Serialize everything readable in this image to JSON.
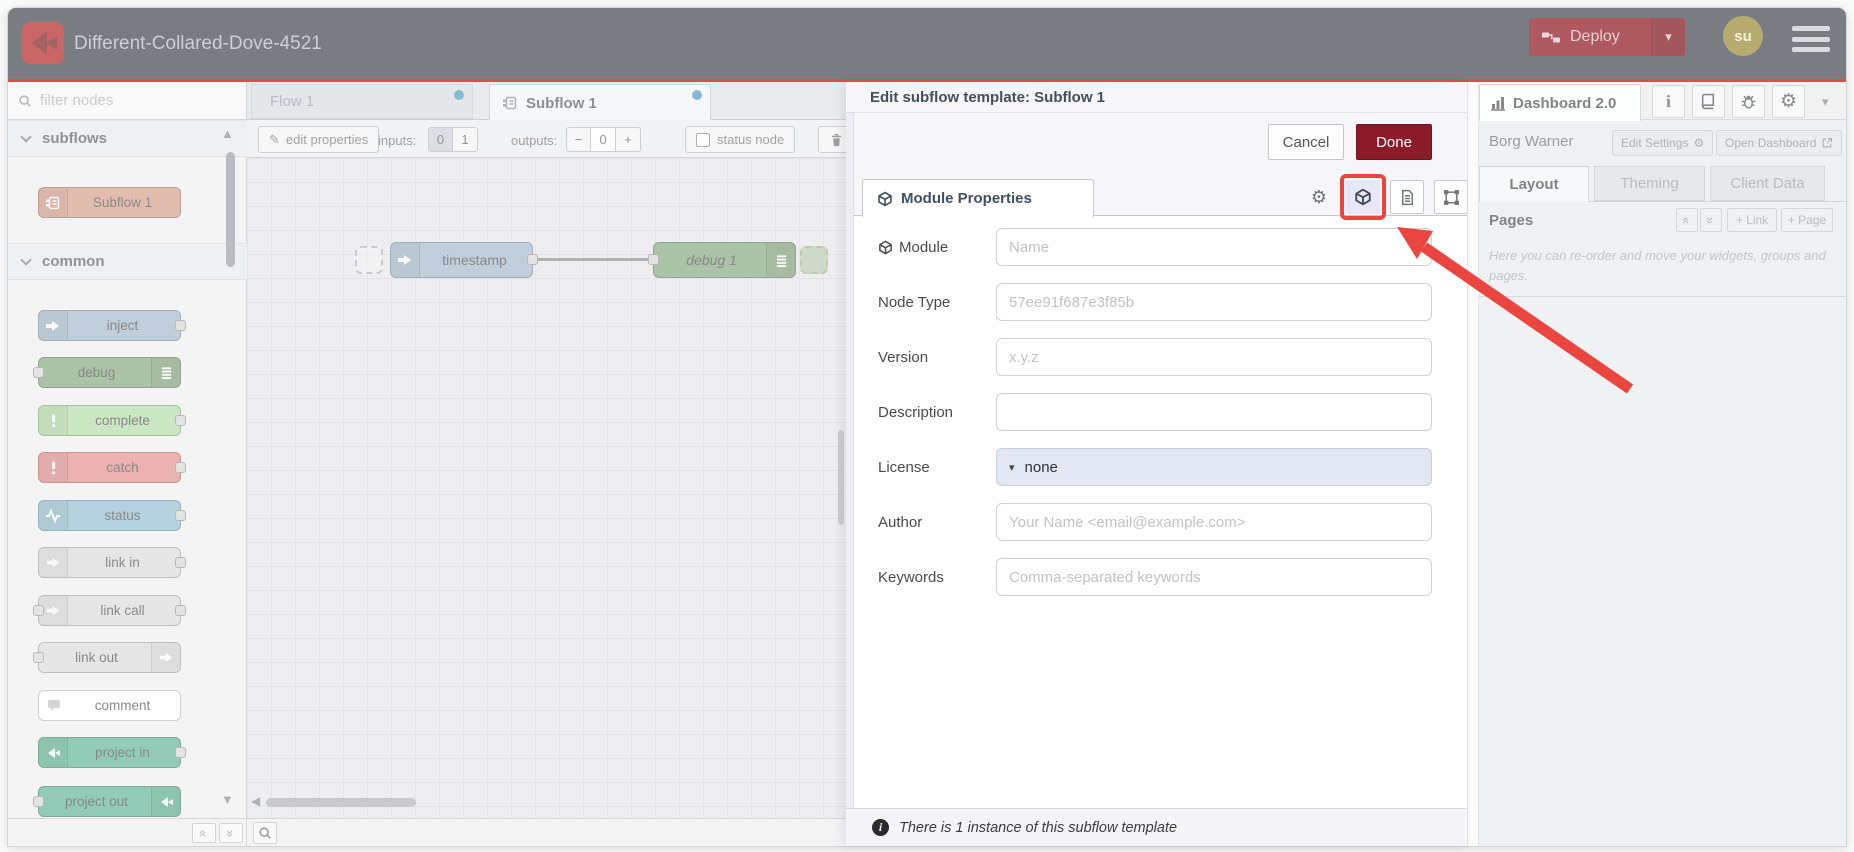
{
  "header": {
    "title": "Different-Collared-Dove-4521",
    "deploy": "Deploy",
    "avatar": "su"
  },
  "icons": {
    "gear": "⚙",
    "pencil": "✎",
    "chevron_down": "▾",
    "triangle_up": "▲",
    "triangle_down": "▼",
    "triangle_left": "◀",
    "double_chevron_up": "«",
    "double_chevron_down": "»",
    "info": "i",
    "exclamation": "!"
  },
  "palette": {
    "filter_placeholder": "filter nodes",
    "sections": [
      {
        "label": "subflows"
      },
      {
        "label": "common"
      }
    ],
    "subflows": [
      {
        "label": "Subflow 1",
        "color": "#d6a18d"
      }
    ],
    "common": [
      {
        "label": "inject",
        "color": "#a6bbcf"
      },
      {
        "label": "debug",
        "color": "#87a980"
      },
      {
        "label": "complete",
        "color": "#b5dba8"
      },
      {
        "label": "catch",
        "color": "#e49191"
      },
      {
        "label": "status",
        "color": "#94c1d0"
      },
      {
        "label": "link in",
        "color": "#dcdcdc"
      },
      {
        "label": "link call",
        "color": "#dcdcdc"
      },
      {
        "label": "link out",
        "color": "#dcdcdc"
      },
      {
        "label": "comment",
        "color": "#ffffff"
      },
      {
        "label": "project in",
        "color": "#63b598"
      },
      {
        "label": "project out",
        "color": "#63b598"
      }
    ]
  },
  "workspace": {
    "tabs": [
      {
        "label": "Flow 1"
      },
      {
        "label": "Subflow 1"
      }
    ],
    "toolbar": {
      "edit_properties": "edit properties",
      "inputs_label": "inputs:",
      "input_options": [
        "0",
        "1"
      ],
      "outputs_label": "outputs:",
      "outputs_minus": "−",
      "outputs_value": "0",
      "outputs_plus": "+",
      "status_node": "status node"
    },
    "nodes": [
      {
        "label": "timestamp"
      },
      {
        "label": "debug 1"
      }
    ]
  },
  "editor": {
    "title": "Edit subflow template: Subflow 1",
    "cancel": "Cancel",
    "done": "Done",
    "tab": "Module Properties",
    "fields": [
      {
        "label": "Module",
        "placeholder": "Name"
      },
      {
        "label": "Node Type",
        "placeholder": "57ee91f687e3f85b"
      },
      {
        "label": "Version",
        "placeholder": "x.y.z"
      },
      {
        "label": "Description",
        "placeholder": ""
      },
      {
        "label": "License",
        "value": "none"
      },
      {
        "label": "Author",
        "placeholder": "Your Name <email@example.com>"
      },
      {
        "label": "Keywords",
        "placeholder": "Comma-separated keywords"
      }
    ],
    "footer_note": "There is 1 instance of this subflow template"
  },
  "sidebar": {
    "tab": "Dashboard 2.0",
    "project_name": "Borg Warner",
    "edit_settings": "Edit Settings",
    "open_dashboard": "Open Dashboard",
    "tabs": [
      {
        "label": "Layout"
      },
      {
        "label": "Theming"
      },
      {
        "label": "Client Data"
      }
    ],
    "pages_title": "Pages",
    "add_link": "+ Link",
    "add_page": "+ Page",
    "hint": "Here you can re-order and move your widgets, groups and pages."
  },
  "colors": {
    "accent_red": "#ea453e",
    "deploy": "#8C101C",
    "done": "#8C1B29",
    "header": "#3f464d",
    "tab_dot": "#4f9dc0"
  }
}
